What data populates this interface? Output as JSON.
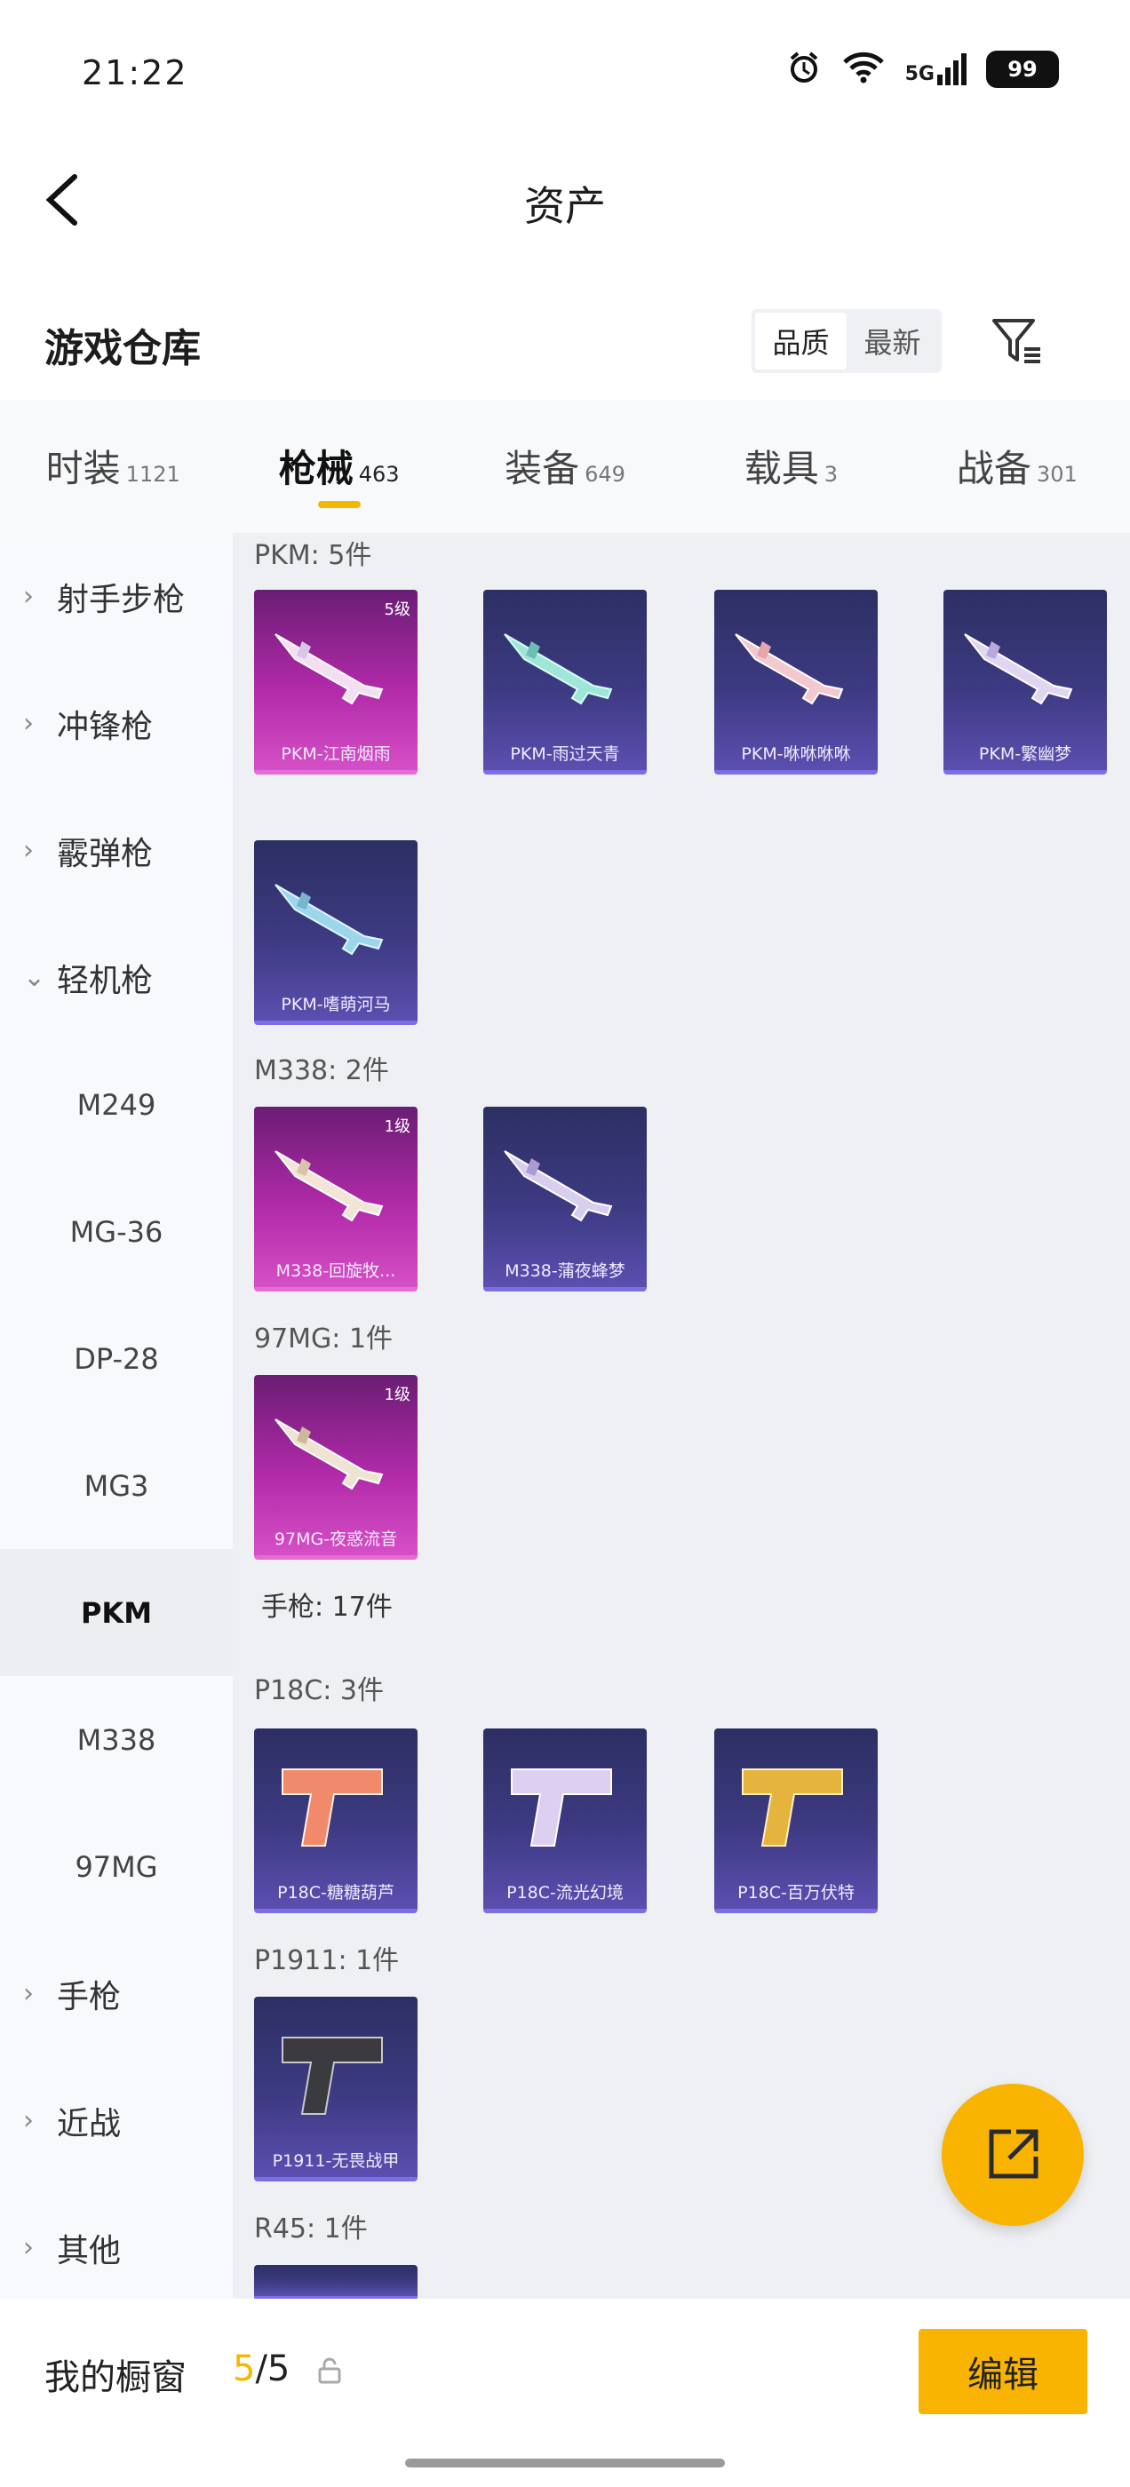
{
  "status": {
    "time": "21:22",
    "network": "5G",
    "battery": "99"
  },
  "header": {
    "title": "资产"
  },
  "warehouse": {
    "title": "游戏仓库",
    "sort_options": [
      "品质",
      "最新"
    ]
  },
  "tabs": [
    {
      "label": "时装",
      "count": "1121"
    },
    {
      "label": "枪械",
      "count": "463",
      "active": true
    },
    {
      "label": "装备",
      "count": "649"
    },
    {
      "label": "载具",
      "count": "3"
    },
    {
      "label": "战备",
      "count": "301"
    }
  ],
  "sidebar": {
    "items": [
      {
        "label": "射手步枪",
        "type": "parent"
      },
      {
        "label": "冲锋枪",
        "type": "parent"
      },
      {
        "label": "霰弹枪",
        "type": "parent"
      },
      {
        "label": "轻机枪",
        "type": "parent-open"
      },
      {
        "label": "M249",
        "type": "child"
      },
      {
        "label": "MG-36",
        "type": "child"
      },
      {
        "label": "DP-28",
        "type": "child"
      },
      {
        "label": "MG3",
        "type": "child"
      },
      {
        "label": "PKM",
        "type": "child",
        "selected": true
      },
      {
        "label": "M338",
        "type": "child"
      },
      {
        "label": "97MG",
        "type": "child"
      },
      {
        "label": "手枪",
        "type": "parent"
      },
      {
        "label": "近战",
        "type": "parent"
      },
      {
        "label": "其他",
        "type": "parent"
      }
    ]
  },
  "content": {
    "groups": {
      "pkm": "PKM: 5件",
      "m338": "M338: 2件",
      "mg97": "97MG: 1件",
      "pistol_section": "手枪: 17件",
      "p18c": "P18C: 3件",
      "p1911": "P1911: 1件",
      "r45": "R45: 1件"
    },
    "cards": [
      {
        "name": "PKM-江南烟雨",
        "level": "5级",
        "rare": true,
        "icon": "machine-gun-icon"
      },
      {
        "name": "PKM-雨过天青",
        "icon": "machine-gun-icon"
      },
      {
        "name": "PKM-咻咻咻咻",
        "icon": "machine-gun-icon"
      },
      {
        "name": "PKM-繁幽梦",
        "icon": "machine-gun-icon"
      },
      {
        "name": "PKM-嗜萌河马",
        "icon": "machine-gun-icon"
      },
      {
        "name": "M338-回旋牧...",
        "level": "1级",
        "rare": true,
        "icon": "machine-gun-icon"
      },
      {
        "name": "M338-蒲夜蜂梦",
        "icon": "machine-gun-icon"
      },
      {
        "name": "97MG-夜惑流音",
        "level": "1级",
        "rare": true,
        "icon": "machine-gun-icon"
      },
      {
        "name": "P18C-糖糖葫芦",
        "icon": "pistol-icon"
      },
      {
        "name": "P18C-流光幻境",
        "icon": "pistol-icon"
      },
      {
        "name": "P18C-百万伏特",
        "icon": "pistol-icon"
      },
      {
        "name": "P1911-无畏战甲",
        "icon": "pistol-icon"
      }
    ]
  },
  "bottom": {
    "showcase_label": "我的橱窗",
    "showcase_current": "5",
    "showcase_total": "/5",
    "edit_label": "编辑"
  },
  "colors": {
    "accent": "#f8b400",
    "rare_card": "#b12aa9",
    "common_card": "#3d3a82"
  }
}
